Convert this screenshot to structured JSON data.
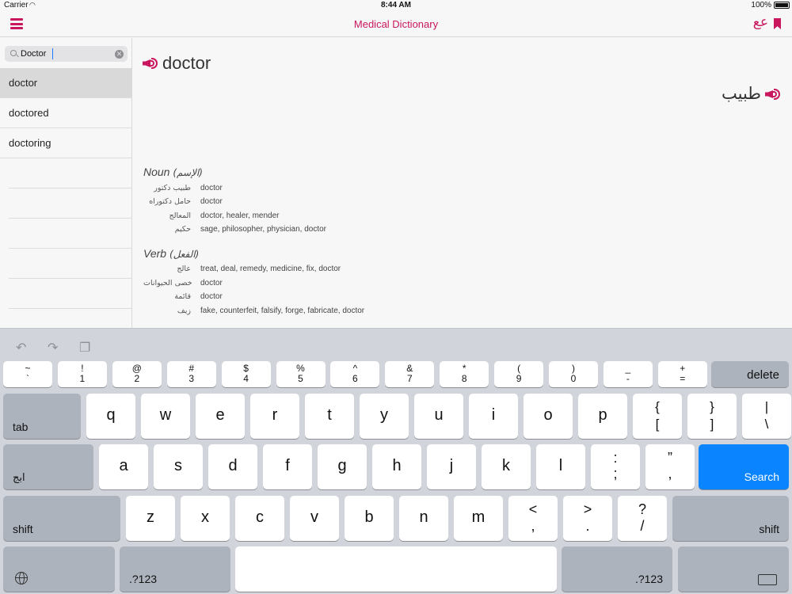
{
  "status": {
    "carrier": "Carrier",
    "wifi": "wifi-icon",
    "time": "8:44 AM",
    "battery": "100%"
  },
  "nav": {
    "title": "Medical Dictionary",
    "lang_toggle": "عع"
  },
  "search": {
    "value": "Doctor",
    "placeholder": ""
  },
  "results": [
    "doctor",
    "doctored",
    "doctoring"
  ],
  "entry": {
    "word": "doctor",
    "arabic": "طبيب",
    "noun_label": "Noun",
    "noun_ar": "(الإسم)",
    "noun": [
      {
        "ar": "طبيب دكتور",
        "en": "doctor"
      },
      {
        "ar": "حامل دكتوراه",
        "en": "doctor"
      },
      {
        "ar": "المعالج",
        "en": "doctor, healer, mender"
      },
      {
        "ar": "حكيم",
        "en": "sage, philosopher, physician, doctor"
      }
    ],
    "verb_label": "Verb",
    "verb_ar": "(الفعل)",
    "verb": [
      {
        "ar": "عالج",
        "en": "treat, deal, remedy, medicine, fix, doctor"
      },
      {
        "ar": "خصى الحيوانات",
        "en": "doctor"
      },
      {
        "ar": "قائمة",
        "en": "doctor"
      },
      {
        "ar": "زيف",
        "en": "fake, counterfeit, falsify, forge, fabricate, doctor"
      }
    ]
  },
  "keyboard": {
    "row1": [
      {
        "top": "~",
        "bot": "`"
      },
      {
        "top": "!",
        "bot": "1"
      },
      {
        "top": "@",
        "bot": "2"
      },
      {
        "top": "#",
        "bot": "3"
      },
      {
        "top": "$",
        "bot": "4"
      },
      {
        "top": "%",
        "bot": "5"
      },
      {
        "top": "^",
        "bot": "6"
      },
      {
        "top": "&",
        "bot": "7"
      },
      {
        "top": "*",
        "bot": "8"
      },
      {
        "top": "(",
        "bot": "9"
      },
      {
        "top": ")",
        "bot": "0"
      },
      {
        "top": "_",
        "bot": "-"
      },
      {
        "top": "+",
        "bot": "="
      }
    ],
    "delete": "delete",
    "tab": "tab",
    "row2": [
      "q",
      "w",
      "e",
      "r",
      "t",
      "y",
      "u",
      "i",
      "o",
      "p"
    ],
    "row2_sym": [
      {
        "top": "{",
        "bot": "["
      },
      {
        "top": "}",
        "bot": "]"
      },
      {
        "top": "|",
        "bot": "\\"
      }
    ],
    "lang": "ابج",
    "row3": [
      "a",
      "s",
      "d",
      "f",
      "g",
      "h",
      "j",
      "k",
      "l"
    ],
    "row3_sym": [
      {
        "top": ":",
        "bot": ";"
      },
      {
        "top": "”",
        "bot": ","
      }
    ],
    "search": "Search",
    "shift": "shift",
    "row4": [
      "z",
      "x",
      "c",
      "v",
      "b",
      "n",
      "m"
    ],
    "row4_sym": [
      {
        "top": "<",
        "bot": ","
      },
      {
        "top": ">",
        "bot": "."
      },
      {
        "top": "?",
        "bot": "/"
      }
    ],
    "numbers": ".?123",
    "toolbar": [
      "undo-icon",
      "redo-icon",
      "paste-icon"
    ]
  },
  "colors": {
    "accent": "#c8175d",
    "search_key": "#0a84ff"
  }
}
